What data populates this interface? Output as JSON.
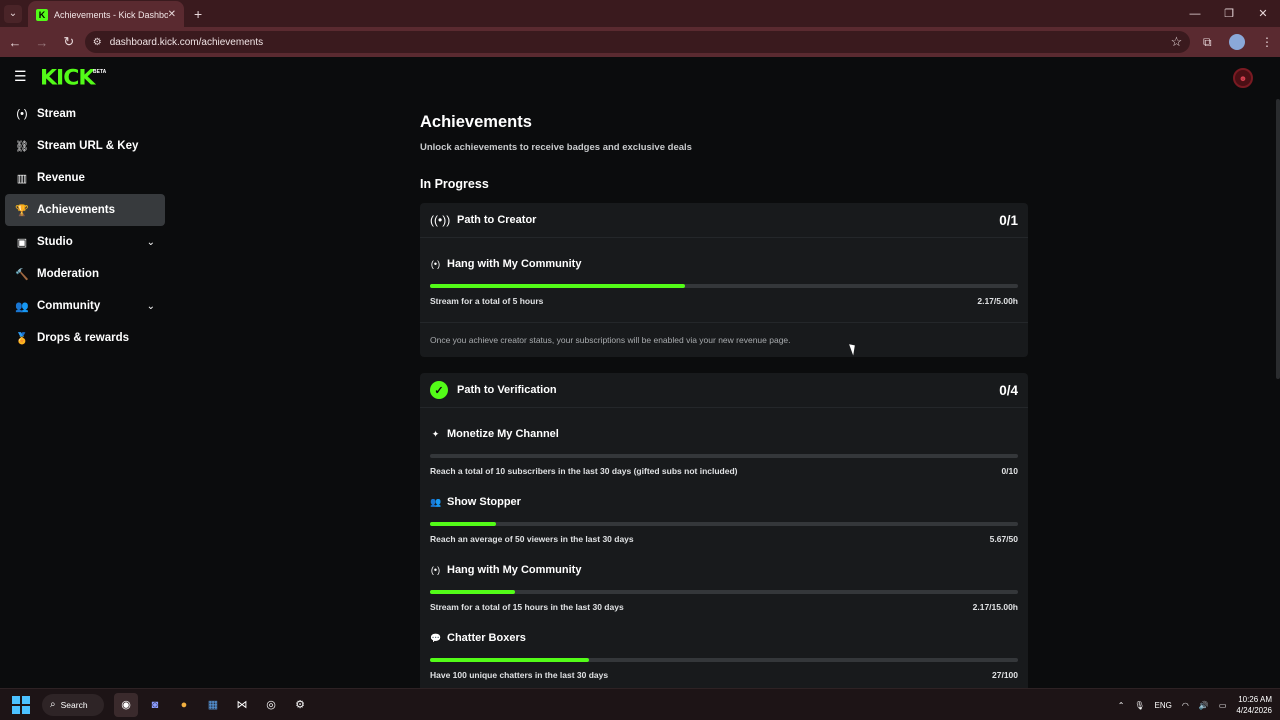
{
  "browser": {
    "tab_list_icon": "chevron-down-icon",
    "tab_title": "Achievements - Kick Dashboard",
    "tab_favicon": "K",
    "new_tab_icon": "plus-icon",
    "url": "dashboard.kick.com/achievements",
    "win_minimize": "—",
    "win_restore": "❐",
    "win_close": "✕"
  },
  "app": {
    "logo": "KICK",
    "beta": "BETA",
    "accent_color": "#53fc18"
  },
  "sidebar": {
    "items": [
      {
        "label": "Stream",
        "icon": "broadcast-icon",
        "glyph": "(•)"
      },
      {
        "label": "Stream URL & Key",
        "icon": "link-icon",
        "glyph": "⛓"
      },
      {
        "label": "Revenue",
        "icon": "chart-icon",
        "glyph": "▥"
      },
      {
        "label": "Achievements",
        "icon": "trophy-icon",
        "glyph": "🏆"
      },
      {
        "label": "Studio",
        "icon": "video-icon",
        "glyph": "▣"
      },
      {
        "label": "Moderation",
        "icon": "hammer-icon",
        "glyph": "🔨"
      },
      {
        "label": "Community",
        "icon": "users-icon",
        "glyph": "👥"
      },
      {
        "label": "Drops & rewards",
        "icon": "gift-icon",
        "glyph": "🏅"
      }
    ]
  },
  "main": {
    "title": "Achievements",
    "subtitle": "Unlock achievements to receive badges and exclusive deals",
    "section": "In Progress",
    "creator": {
      "title": "Path to Creator",
      "count": "0/1",
      "achievements": [
        {
          "title": "Hang with My Community",
          "desc": "Stream for a total of 5 hours",
          "value": "2.17/5.00h",
          "progress": 0.434
        }
      ],
      "note": "Once you achieve creator status, your subscriptions will be enabled via your new revenue page."
    },
    "verification": {
      "title": "Path to Verification",
      "count": "0/4",
      "achievements": [
        {
          "title": "Monetize My Channel",
          "desc": "Reach a total of 10 subscribers in the last 30 days (gifted subs not included)",
          "value": "0/10",
          "progress": 0.0
        },
        {
          "title": "Show Stopper",
          "desc": "Reach an average of 50 viewers in the last 30 days",
          "value": "5.67/50",
          "progress": 0.113
        },
        {
          "title": "Hang with My Community",
          "desc": "Stream for a total of 15 hours in the last 30 days",
          "value": "2.17/15.00h",
          "progress": 0.145
        },
        {
          "title": "Chatter Boxers",
          "desc": "Have 100 unique chatters in the last 30 days",
          "value": "27/100",
          "progress": 0.27
        }
      ]
    }
  },
  "taskbar": {
    "search": "Search",
    "lang": "ENG",
    "time": "10:26 AM",
    "date": "4/24/2026"
  }
}
